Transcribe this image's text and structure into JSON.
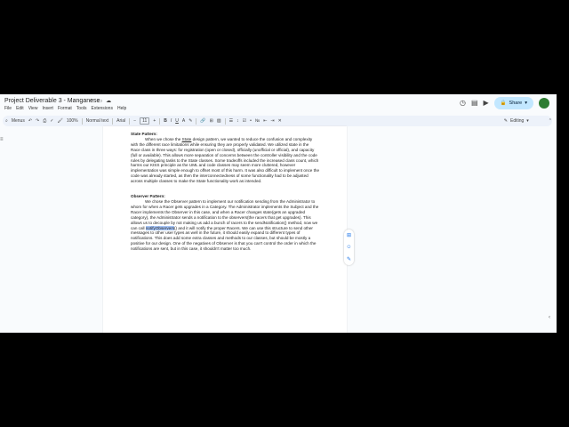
{
  "window": {
    "doc_title": "Project Deliverable 3 - Manganese",
    "title_icons": [
      "star-icon",
      "folder-icon",
      "cloud-icon"
    ]
  },
  "menus": [
    "File",
    "Edit",
    "View",
    "Insert",
    "Format",
    "Tools",
    "Extensions",
    "Help"
  ],
  "header_right": {
    "share_label": "Share"
  },
  "toolbar": {
    "search_menus": "Menus",
    "zoom": "100%",
    "style": "Normal text",
    "font": "Arial",
    "font_size": "11",
    "bold": "B",
    "italic": "I",
    "underline": "U",
    "text_color": "A",
    "mode": "Editing"
  },
  "document": {
    "state_heading": "State Pattern:",
    "state_pre": "When we chose the ",
    "state_word": "State",
    "state_post": " design pattern, we wanted to reduce the confusion and complexity with the different race limitations while ensuring they are properly validated. We utilized state in the Race class in three ways: for registration (open or closed), officially (unofficial or official), and capacity (full or available). This allows more separation of concerns between the controller visibility and the code rules by delegating tasks to the State classes. Some tradeoffs included the increased class count, which harms our KISS principle as the UML and code classes may seem more cluttered, however implementation was simple enough to offset most of this harm. It was also difficult to implement once the code was already started, as then the interconnectedness of some functionality had to be adjusted across multiple classes to make the State functionality work as intended.",
    "observer_heading": "Observer Pattern:",
    "observer_pre": "We chose the Observer pattern to implement our notification sending from the Administrator to whom for when a Racer gets upgrades in a Category. The Administrator implements the Subject and the Racer implements the Observer in this case, and when a Racer changes state(gets an upgraded category), the Administrator sends a notification to the observers(the racers that get upgrades). This allows us to decouple by not making us add a bunch of racers to the sendNotification() method, now we can call ",
    "observer_highlight": "notifyObservers",
    "observer_post": "() and it will notify the proper Racers. We can use this structure to send other messages to other user types as well in the future, it should easily expand to different types of notifications. This does add some extra classes and methods to our classes, but should be mostly a positive for our design. One of the negatives of Observer is that you can't control the order in which the notifications are sent, but in this case, it shouldn't matter too much."
  },
  "colors": {
    "share_bg": "#c2e7ff",
    "toolbar_bg": "#edf2fa",
    "highlight": "#a8c7fa"
  }
}
